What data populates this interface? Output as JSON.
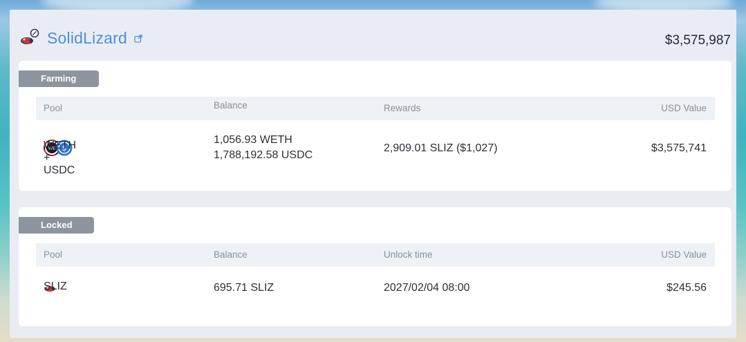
{
  "protocol": {
    "name": "SolidLizard",
    "total_usd": "$3,575,987",
    "logo_icon": "solidlizard-logo-icon",
    "link_icon": "external-link-icon"
  },
  "farming": {
    "tag": "Farming",
    "columns": [
      "Pool",
      "Balance",
      "Rewards",
      "USD Value"
    ],
    "rows": [
      {
        "pool": "WETH + USDC",
        "pool_icons": [
          "weth-icon",
          "usdc-icon"
        ],
        "balance_lines": [
          "1,056.93 WETH",
          "1,788,192.58 USDC"
        ],
        "rewards": "2,909.01 SLIZ ($1,027)",
        "usd_value": "$3,575,741"
      }
    ]
  },
  "locked": {
    "tag": "Locked",
    "columns": [
      "Pool",
      "Balance",
      "Unlock time",
      "USD Value"
    ],
    "rows": [
      {
        "pool": "SLIZ",
        "pool_icons": [
          "sliz-icon"
        ],
        "balance": "695.71 SLIZ",
        "unlock_time": "2027/02/04 08:00",
        "usd_value": "$245.56"
      }
    ]
  },
  "colors": {
    "accent": "#4a8ee0",
    "tag_bg": "#8e949f",
    "panel_bg": "#e9edf3",
    "header_bg": "#eef1f5"
  }
}
